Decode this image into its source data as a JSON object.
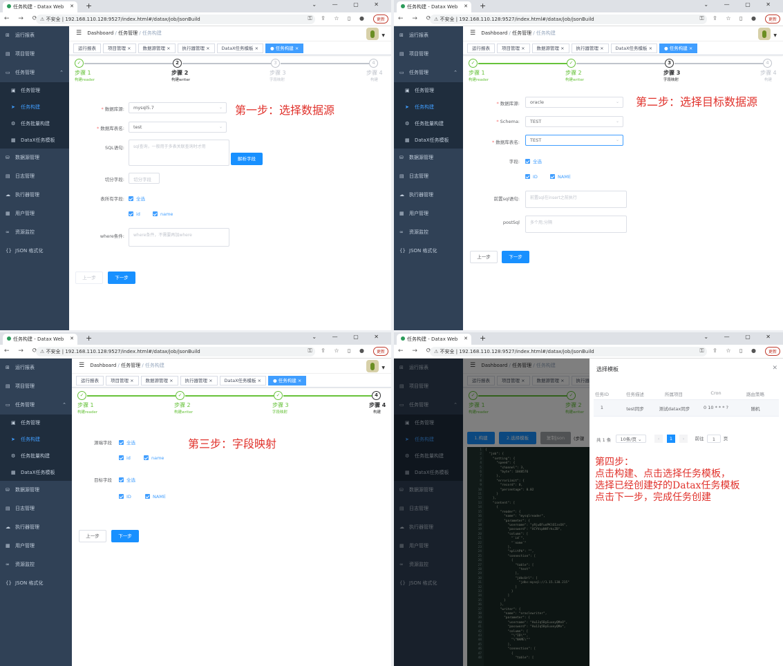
{
  "browser": {
    "tab_title_build": "任务构建 - Datax Web",
    "tab_title_p3": "任务构建 - Datax Web",
    "tab_title_p4": "任务构建 - Datax Web",
    "url_warning": "不安全",
    "url": "192.168.110.128:9527/index.html#/datax/job/jsonBuild",
    "update_label": "更新",
    "new_tab": "+"
  },
  "sidebar": {
    "items": [
      "运行报表",
      "项目管理",
      "任务管理",
      "任务管理",
      "任务构建",
      "任务批量构建",
      "DataX任务模板",
      "数据源管理",
      "日志管理",
      "执行器管理",
      "用户管理",
      "资源监控",
      "JSON 格式化"
    ]
  },
  "navbar": {
    "crumbs": [
      "Dashboard",
      "任务管理",
      "任务构建"
    ]
  },
  "tags": [
    "运行报表",
    "项目管理",
    "数据源管理",
    "执行器管理",
    "DataX任务模板",
    "● 任务构建"
  ],
  "steps": [
    {
      "title": "步骤 1",
      "desc": "构建reader"
    },
    {
      "title": "步骤 2",
      "desc": "构建writer"
    },
    {
      "title": "步骤 3",
      "desc": "字段映射"
    },
    {
      "title": "步骤 4",
      "desc": "构建"
    }
  ],
  "pane1": {
    "annotation": "第一步：选择数据源",
    "labels": {
      "datasource": "数据库源:",
      "table": "数据库表名:",
      "sql": "SQL语句:",
      "split": "切分字段:",
      "columns": "表所有字段:",
      "where": "where条件:"
    },
    "datasource_value": "mysql5.7",
    "table_value": "test",
    "sql_placeholder": "sql查询，一般用于多表关联查询时才用",
    "parse_button": "解析字段",
    "split_placeholder": "切分字段",
    "select_all": "全选",
    "columns": [
      "id",
      "name"
    ],
    "where_placeholder": "where条件，不需要再加where",
    "prev": "上一步",
    "next": "下一步"
  },
  "pane2": {
    "annotation": "第二步：选择目标数据源",
    "labels": {
      "datasource": "数据库源:",
      "schema": "Schema:",
      "table": "数据库表名:",
      "columns": "字段:",
      "presql": "前置sql语句:",
      "postsql": "postSql"
    },
    "datasource_value": "oracle",
    "schema_value": "TEST",
    "table_value": "TEST",
    "select_all": "全选",
    "columns": [
      "ID",
      "NAME"
    ],
    "presql_placeholder": "前置sql在insert之前执行",
    "postsql_placeholder": "多个用;分隔",
    "prev": "上一步",
    "next": "下一步"
  },
  "pane3": {
    "annotation": "第三步：字段映射",
    "source_label": "源端字段",
    "target_label": "目标字段",
    "select_all": "全选",
    "source_columns": [
      "id",
      "name"
    ],
    "target_columns": [
      "ID",
      "NAME"
    ],
    "prev": "上一步",
    "next": "下一步"
  },
  "pane4": {
    "annotation_lines": [
      "第四步：",
      "点击构建、点击选择任务模板，",
      "选择已经创建好的Datax任务模板",
      "点击下一步，完成任务创建"
    ],
    "buttons": {
      "build": "1.构建",
      "template": "2.选择模板",
      "copy": "复制json",
      "hint": "(步骤"
    },
    "dialog": {
      "title": "选择模板",
      "columns": [
        "任务ID",
        "任务描述",
        "所属项目",
        "Cron",
        "路由策略"
      ],
      "row": [
        "1",
        "test同步",
        "测试datax同步",
        "0 10 * * * ?",
        "随机"
      ],
      "total": "共 1 条",
      "page_size": "10条/页",
      "current_page": "1",
      "goto_label": "前往",
      "goto_value": "1",
      "page_suffix": "页"
    },
    "code_lines": [
      "{",
      "  \"job\": {",
      "    \"setting\": {",
      "      \"speed\": {",
      "        \"channel\": 3,",
      "        \"byte\": 1048576",
      "      },",
      "      \"errorLimit\": {",
      "        \"record\": 0,",
      "        \"percentage\": 0.02",
      "      }",
      "    },",
      "    \"content\": [",
      "      {",
      "        \"reader\": {",
      "          \"name\": \"mysqlreader\",",
      "          \"parameter\": {",
      "            \"username\": \"yRjwDFuoPKlOIzsOX\",",
      "            \"password\": \"XCYVcpNHFrkcZB\",",
      "            \"column\": [",
      "              \"`id`\",",
      "              \"`name`\"",
      "            ],",
      "            \"splitPk\": \"\",",
      "            \"connection\": [",
      "              {",
      "                \"table\": [",
      "                  \"test\"",
      "                ],",
      "                \"jdbcUrl\": [",
      "                  \"jdbc:mysql://1.15.130.215\"",
      "                ]",
      "              }",
      "            ]",
      "          }",
      "        },",
      "        \"writer\": {",
      "          \"name\": \"oraclewriter\",",
      "          \"parameter\": {",
      "            \"username\": \"Hu1Jq5ByEuxeyQMoO\",",
      "            \"password\": \"Hu1Jq5ByEuxeyQMo\",",
      "            \"column\": [",
      "              \"\\\"ID\\\"\",",
      "              \"\\\"NAME\\\"\"",
      "            ],",
      "            \"connection\": [",
      "              {",
      "                \"table\": ["
    ]
  }
}
